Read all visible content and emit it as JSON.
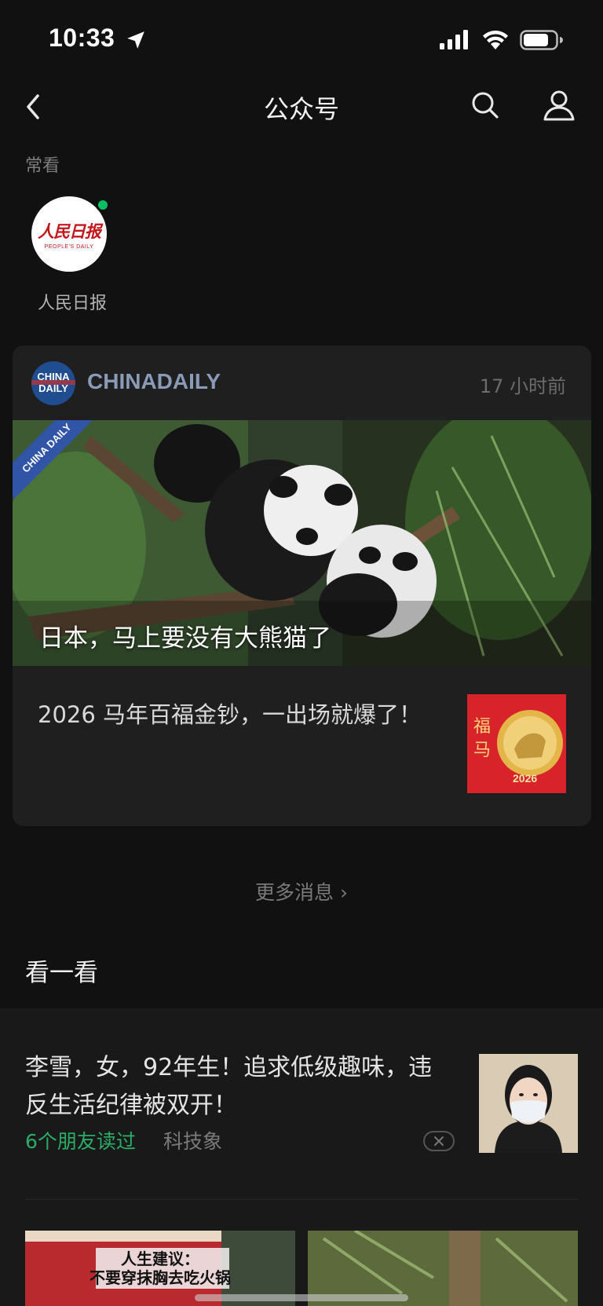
{
  "status": {
    "time": "10:33"
  },
  "nav": {
    "title": "公众号"
  },
  "frequent": {
    "label": "常看",
    "items": [
      {
        "name": "人民日报",
        "logo_text": "人民日报",
        "logo_sub": "PEOPLE'S DAILY"
      }
    ]
  },
  "card": {
    "account": "CHINADAILY",
    "logo_text": "CHINA DAILY",
    "time_ago": "17 小时前",
    "hero_headline": "日本，马上要没有大熊猫了",
    "hero_badge": "CHINA DAILY",
    "article_title": "2026 马年百福金钞，一出场就爆了！",
    "thumb_year": "2026"
  },
  "more_link": "更多消息 ›",
  "kan": {
    "title": "看一看",
    "feed_title": "李雪，女，92年生！追求低级趣味，违反生活纪律被双开！",
    "friends_read": "6个朋友读过",
    "source": "科技象",
    "bottom_left_caption_line1": "人生建议：",
    "bottom_left_caption_line2": "不要穿抹胸去吃火锅"
  },
  "colors": {
    "accent_green": "#07c160",
    "friends_green": "#2aae67",
    "background": "#111111",
    "card": "#1f1f1f"
  }
}
